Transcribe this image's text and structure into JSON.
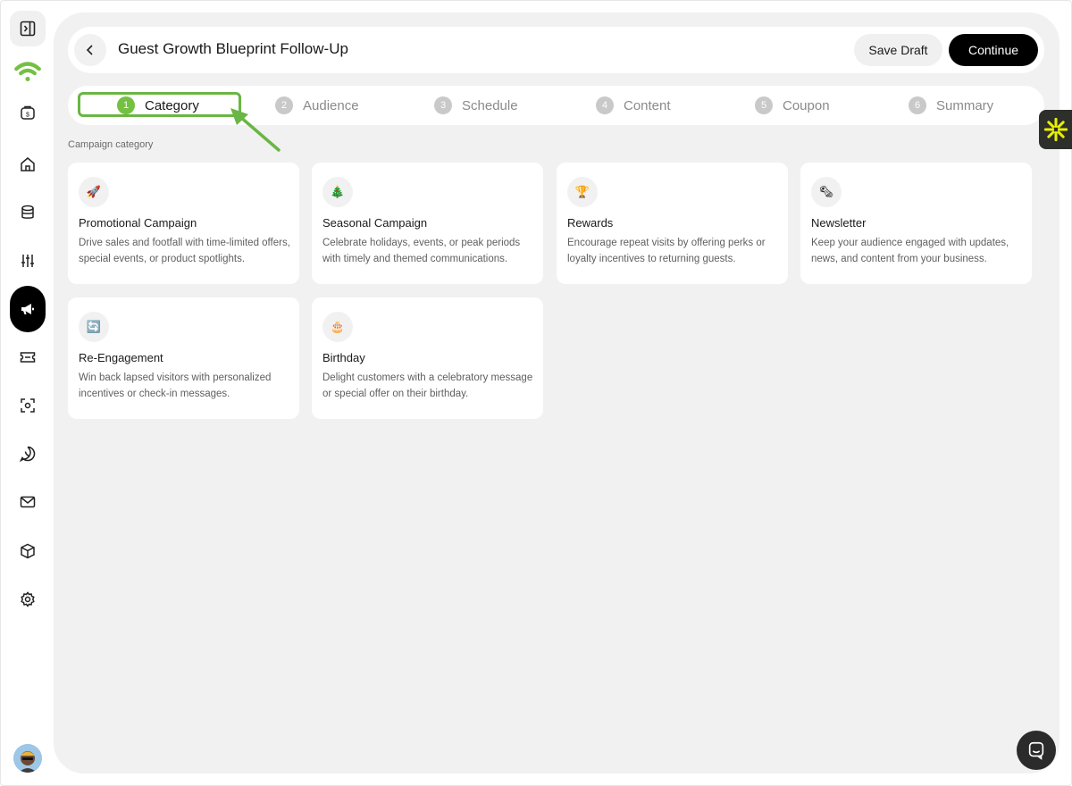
{
  "header": {
    "title": "Guest Growth Blueprint Follow-Up",
    "save_label": "Save Draft",
    "continue_label": "Continue"
  },
  "steps": [
    {
      "num": "1",
      "label": "Category",
      "active": true
    },
    {
      "num": "2",
      "label": "Audience"
    },
    {
      "num": "3",
      "label": "Schedule"
    },
    {
      "num": "4",
      "label": "Content"
    },
    {
      "num": "5",
      "label": "Coupon"
    },
    {
      "num": "6",
      "label": "Summary"
    }
  ],
  "section_label": "Campaign category",
  "categories": [
    {
      "icon": "🚀",
      "icon_name": "rocket-icon",
      "title": "Promotional Campaign",
      "description": "Drive sales and footfall with time-limited offers, special events, or product spotlights."
    },
    {
      "icon": "🎄",
      "icon_name": "tree-icon",
      "title": "Seasonal Campaign",
      "description": "Celebrate holidays, events, or peak periods with timely and themed communications."
    },
    {
      "icon": "🏆",
      "icon_name": "trophy-icon",
      "title": "Rewards",
      "description": "Encourage repeat visits by offering perks or loyalty incentives to returning guests."
    },
    {
      "icon": "🗞",
      "icon_name": "newspaper-icon",
      "title": "Newsletter",
      "description": "Keep your audience engaged with updates, news, and content from your business."
    },
    {
      "icon": "🔄",
      "icon_name": "refresh-icon",
      "title": "Re-Engagement",
      "description": "Win back lapsed visitors with personalized incentives or check-in messages."
    },
    {
      "icon": "🎂",
      "icon_name": "cake-icon",
      "title": "Birthday",
      "description": "Delight customers with a celebratory message or special offer on their birthday."
    }
  ],
  "colors": {
    "accent_green": "#74c043",
    "highlight_green": "#6ab644",
    "primary_black": "#000000",
    "panel_bg": "#f1f1f1"
  }
}
